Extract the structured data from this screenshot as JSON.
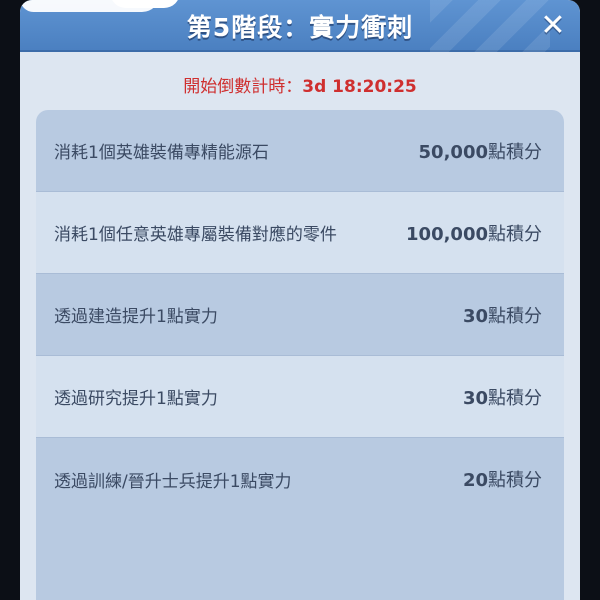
{
  "dialog": {
    "title": "第5階段：實力衝刺",
    "close_icon": "close-icon"
  },
  "countdown": {
    "label": "開始倒數計時：",
    "value": "3d 18:20:25"
  },
  "tasks": [
    {
      "desc": "消耗1個英雄裝備專精能源石",
      "points": "50,000",
      "unit": "點積分"
    },
    {
      "desc": "消耗1個任意英雄專屬裝備對應的零件",
      "points": "100,000",
      "unit": "點積分"
    },
    {
      "desc": "透過建造提升1點實力",
      "points": "30",
      "unit": "點積分"
    },
    {
      "desc": "透過研究提升1點實力",
      "points": "30",
      "unit": "點積分"
    },
    {
      "desc": "透過訓練/晉升士兵提升1點實力",
      "points": "20",
      "unit": "點積分"
    }
  ],
  "colors": {
    "header": "#5a8fd0",
    "countdown": "#cf2f2f",
    "text": "#3b4a63"
  }
}
